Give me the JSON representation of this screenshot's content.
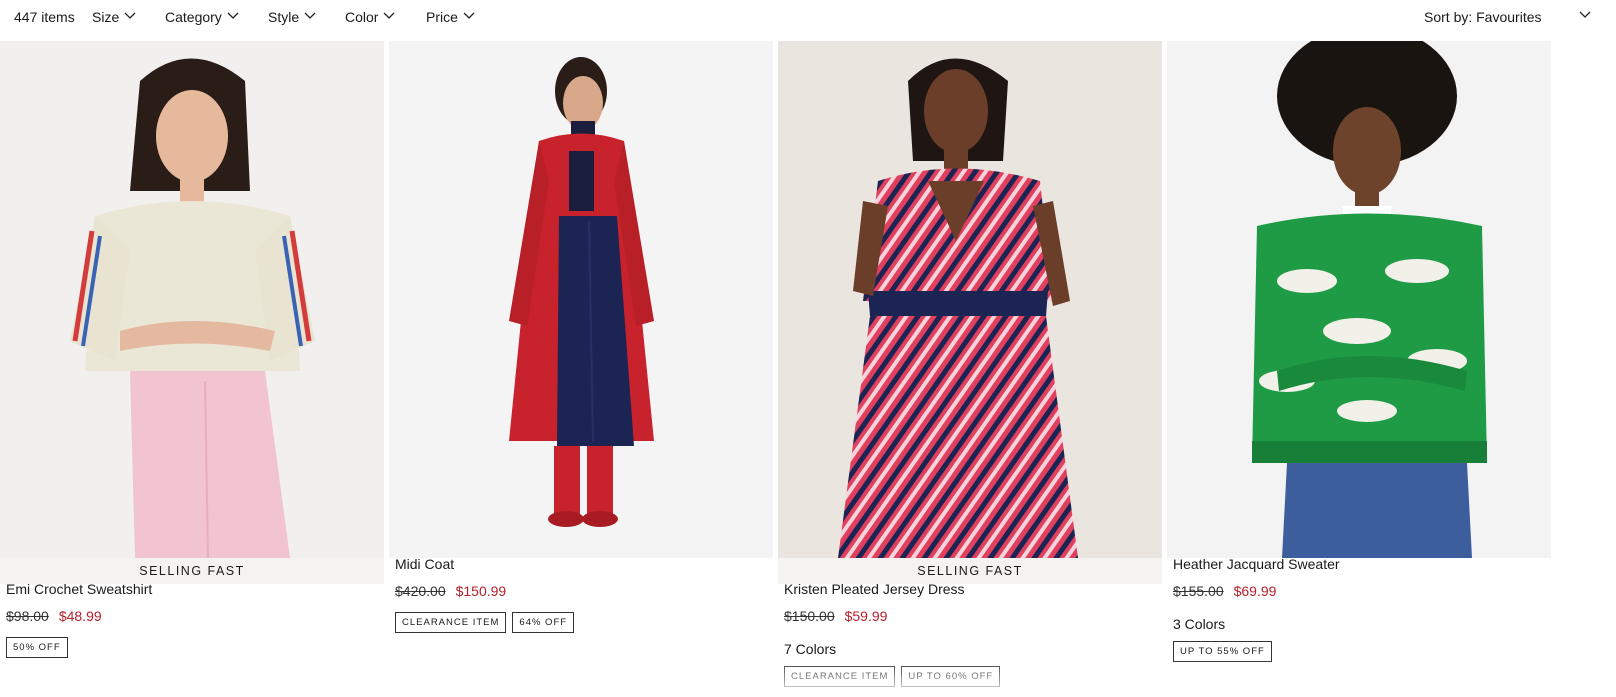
{
  "filters": {
    "item_count": "447 items",
    "size": "Size",
    "category": "Category",
    "style": "Style",
    "color": "Color",
    "price": "Price",
    "sort": "Sort by: Favourites"
  },
  "products": [
    {
      "ribbon": "SELLING FAST",
      "name": "Emi Crochet Sweatshirt",
      "was_price": "$98.00",
      "now_price": "$48.99",
      "colors": "",
      "badges": [
        "50% OFF"
      ]
    },
    {
      "ribbon": "",
      "name": "Midi Coat",
      "was_price": "$420.00",
      "now_price": "$150.99",
      "colors": "",
      "badges": [
        "CLEARANCE ITEM",
        "64% OFF"
      ]
    },
    {
      "ribbon": "SELLING FAST",
      "name": "Kristen Pleated Jersey Dress",
      "was_price": "$150.00",
      "now_price": "$59.99",
      "colors": "7 Colors",
      "badges": [
        "CLEARANCE ITEM",
        "UP TO 60% OFF"
      ]
    },
    {
      "ribbon": "",
      "name": "Heather Jacquard Sweater",
      "was_price": "$155.00",
      "now_price": "$69.99",
      "colors": "3 Colors",
      "badges": [
        "UP TO 55% OFF"
      ]
    }
  ]
}
